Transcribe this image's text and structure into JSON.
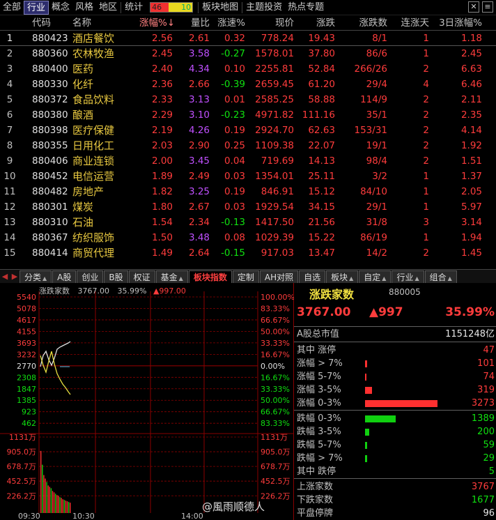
{
  "nav": {
    "items": [
      "全部",
      "行业",
      "概念",
      "风格",
      "地区",
      "统计"
    ],
    "active": "行业",
    "ratio_up": "46",
    "ratio_down": "10",
    "extra": [
      "板块地图",
      "主题投资",
      "热点专题"
    ]
  },
  "table": {
    "headers": {
      "idx": "",
      "code": "代码",
      "name": "名称",
      "pct": "涨幅%↓",
      "vr": "量比",
      "spd": "涨速%",
      "price": "现价",
      "chg": "涨跌",
      "ud": "涨跌数",
      "days": "连涨天",
      "d3": "3日涨幅%"
    },
    "rows": [
      {
        "idx": "1",
        "code": "880423",
        "name": "酒店餐饮",
        "pct": "2.56",
        "vr": "2.61",
        "spd": "0.32",
        "price": "778.24",
        "chg": "19.43",
        "ud": "8/1",
        "days": "1",
        "d3": "1.18"
      },
      {
        "idx": "2",
        "code": "880360",
        "name": "农林牧渔",
        "pct": "2.45",
        "vr": "3.58",
        "spd": "-0.27",
        "price": "1578.01",
        "chg": "37.80",
        "ud": "86/6",
        "days": "1",
        "d3": "2.45"
      },
      {
        "idx": "3",
        "code": "880400",
        "name": "医药",
        "pct": "2.40",
        "vr": "4.34",
        "spd": "0.10",
        "price": "2255.81",
        "chg": "52.84",
        "ud": "266/26",
        "days": "2",
        "d3": "6.63"
      },
      {
        "idx": "4",
        "code": "880330",
        "name": "化纤",
        "pct": "2.36",
        "vr": "2.66",
        "spd": "-0.39",
        "price": "2659.45",
        "chg": "61.20",
        "ud": "29/4",
        "days": "4",
        "d3": "6.46"
      },
      {
        "idx": "5",
        "code": "880372",
        "name": "食品饮料",
        "pct": "2.33",
        "vr": "3.13",
        "spd": "0.01",
        "price": "2585.25",
        "chg": "58.88",
        "ud": "114/9",
        "days": "2",
        "d3": "2.11"
      },
      {
        "idx": "6",
        "code": "880380",
        "name": "酿酒",
        "pct": "2.29",
        "vr": "3.10",
        "spd": "-0.23",
        "price": "4971.82",
        "chg": "111.16",
        "ud": "35/1",
        "days": "2",
        "d3": "2.35"
      },
      {
        "idx": "7",
        "code": "880398",
        "name": "医疗保健",
        "pct": "2.19",
        "vr": "4.26",
        "spd": "0.19",
        "price": "2924.70",
        "chg": "62.63",
        "ud": "153/31",
        "days": "2",
        "d3": "4.14"
      },
      {
        "idx": "8",
        "code": "880355",
        "name": "日用化工",
        "pct": "2.03",
        "vr": "2.90",
        "spd": "0.25",
        "price": "1109.38",
        "chg": "22.07",
        "ud": "19/1",
        "days": "2",
        "d3": "1.92"
      },
      {
        "idx": "9",
        "code": "880406",
        "name": "商业连锁",
        "pct": "2.00",
        "vr": "3.45",
        "spd": "0.04",
        "price": "719.69",
        "chg": "14.13",
        "ud": "98/4",
        "days": "2",
        "d3": "1.51"
      },
      {
        "idx": "10",
        "code": "880452",
        "name": "电信运营",
        "pct": "1.89",
        "vr": "2.49",
        "spd": "0.03",
        "price": "1354.01",
        "chg": "25.11",
        "ud": "3/2",
        "days": "1",
        "d3": "1.37"
      },
      {
        "idx": "11",
        "code": "880482",
        "name": "房地产",
        "pct": "1.82",
        "vr": "3.25",
        "spd": "0.19",
        "price": "846.91",
        "chg": "15.12",
        "ud": "84/10",
        "days": "1",
        "d3": "2.05"
      },
      {
        "idx": "12",
        "code": "880301",
        "name": "煤炭",
        "pct": "1.80",
        "vr": "2.67",
        "spd": "0.03",
        "price": "1929.54",
        "chg": "34.15",
        "ud": "29/1",
        "days": "1",
        "d3": "5.97"
      },
      {
        "idx": "13",
        "code": "880310",
        "name": "石油",
        "pct": "1.54",
        "vr": "2.34",
        "spd": "-0.13",
        "price": "1417.50",
        "chg": "21.56",
        "ud": "31/8",
        "days": "3",
        "d3": "3.14"
      },
      {
        "idx": "14",
        "code": "880367",
        "name": "纺织服饰",
        "pct": "1.50",
        "vr": "3.48",
        "spd": "0.08",
        "price": "1029.39",
        "chg": "15.22",
        "ud": "86/19",
        "days": "1",
        "d3": "1.94"
      },
      {
        "idx": "15",
        "code": "880414",
        "name": "商贸代理",
        "pct": "1.49",
        "vr": "2.64",
        "spd": "-0.15",
        "price": "917.03",
        "chg": "13.47",
        "ud": "14/2",
        "days": "2",
        "d3": "1.45"
      }
    ]
  },
  "tabs": [
    {
      "label": "分类",
      "caret": true
    },
    {
      "label": "A股",
      "caret": false
    },
    {
      "label": "创业",
      "caret": false
    },
    {
      "label": "B股",
      "caret": false
    },
    {
      "label": "权证",
      "caret": false
    },
    {
      "label": "基金",
      "caret": true
    },
    {
      "label": "板块指数",
      "caret": false
    },
    {
      "label": "定制",
      "caret": false
    },
    {
      "label": "AH对照",
      "caret": false
    },
    {
      "label": "自选",
      "caret": false
    },
    {
      "label": "板块",
      "caret": true
    },
    {
      "label": "自定",
      "caret": true
    },
    {
      "label": "行业",
      "caret": true
    },
    {
      "label": "组合",
      "caret": true
    }
  ],
  "tabs_active": "板块指数",
  "chart": {
    "title": "涨跌家数",
    "value": "3767.00",
    "pct": "35.99%",
    "delta": "▲997.00",
    "left_ticks": [
      "5540",
      "5078",
      "4617",
      "4155",
      "3693",
      "3232",
      "2770",
      "2308",
      "1847",
      "1385",
      "923",
      "462"
    ],
    "right_ticks": [
      "100.00%",
      "83.33%",
      "66.67%",
      "50.00%",
      "33.33%",
      "16.67%",
      "0.00%",
      "16.67%",
      "33.33%",
      "50.00%",
      "66.67%",
      "83.33%"
    ],
    "vol_left_ticks": [
      "1131万",
      "905.0万",
      "678.7万",
      "452.5万",
      "226.2万"
    ],
    "vol_right_ticks": [
      "1131万",
      "905.0万",
      "678.7万",
      "452.5万",
      "226.2万"
    ],
    "time_ticks": [
      "09:30",
      "10:30",
      "14:00"
    ],
    "colors": {
      "up": "#ff3030",
      "down": "#10d010",
      "line_white": "#e0e0e0",
      "line_yellow": "#e8e040",
      "grid": "#8b0000"
    }
  },
  "stats": {
    "title": "涨跌家数",
    "code": "880005",
    "value": "3767.00",
    "delta": "▲997",
    "pct": "35.99%",
    "market_cap_label": "A股总市值",
    "market_cap_value": "1151248亿",
    "rows_up": [
      {
        "label": "其中 涨停",
        "value": "47",
        "ratio": 0.0,
        "color": "#ff3030"
      },
      {
        "label": "涨幅 > 7%",
        "value": "101",
        "ratio": 0.031,
        "color": "#ff3030"
      },
      {
        "label": "涨幅 5-7%",
        "value": "74",
        "ratio": 0.023,
        "color": "#ff3030"
      },
      {
        "label": "涨幅 3-5%",
        "value": "319",
        "ratio": 0.097,
        "color": "#ff3030"
      },
      {
        "label": "涨幅 0-3%",
        "value": "3273",
        "ratio": 1.0,
        "color": "#ff3030"
      }
    ],
    "rows_down": [
      {
        "label": "跌幅 0-3%",
        "value": "1389",
        "ratio": 0.424,
        "color": "#10d010"
      },
      {
        "label": "跌幅 3-5%",
        "value": "200",
        "ratio": 0.061,
        "color": "#10d010"
      },
      {
        "label": "跌幅 5-7%",
        "value": "59",
        "ratio": 0.018,
        "color": "#10d010"
      },
      {
        "label": "跌幅 > 7%",
        "value": "29",
        "ratio": 0.009,
        "color": "#10d010"
      },
      {
        "label": "其中 跌停",
        "value": "5",
        "ratio": 0.0,
        "color": "#10d010"
      }
    ],
    "summary": [
      {
        "label": "上涨家数",
        "value": "3767",
        "color": "#ff3c3c"
      },
      {
        "label": "下跌家数",
        "value": "1677",
        "color": "#10e010"
      },
      {
        "label": "平盘停牌",
        "value": "96",
        "color": "#e8e8e8"
      }
    ]
  },
  "watermark": "@風雨顺德人"
}
